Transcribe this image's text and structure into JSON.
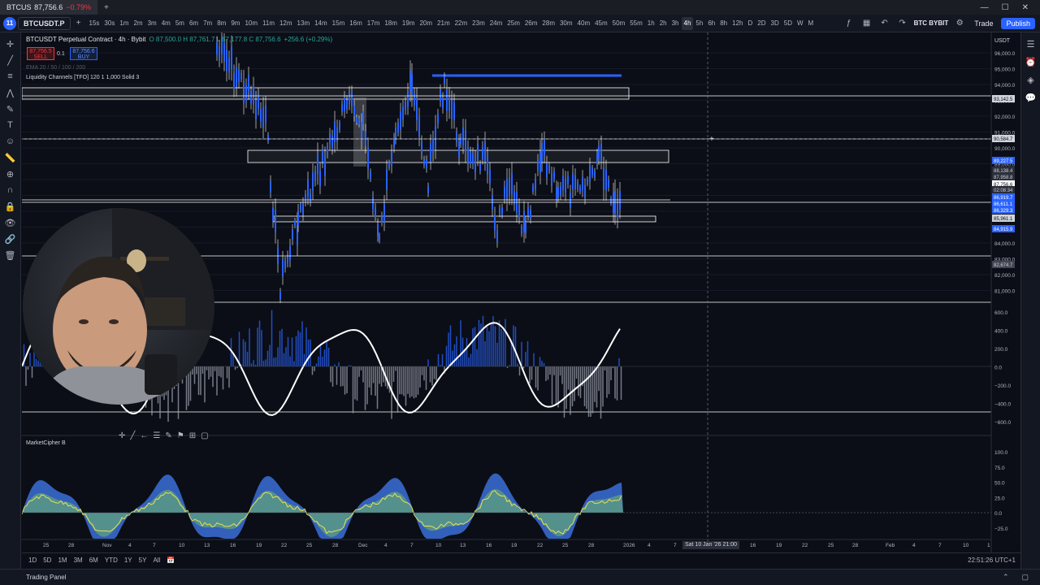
{
  "browser": {
    "tab_title": "BTCUSDT.P",
    "tab_price": "87,756.6",
    "tab_change": "−0.79%",
    "new_tab": "+",
    "window_controls": [
      "—",
      "☐",
      "✕"
    ]
  },
  "toolbar": {
    "symbol": "BTCUSDT.P",
    "timeframes": [
      "15s",
      "30s",
      "1m",
      "2m",
      "3m",
      "4m",
      "5m",
      "6m",
      "7m",
      "8m",
      "9m",
      "10m",
      "11m",
      "12m",
      "13m",
      "14m",
      "15m",
      "16m",
      "17m",
      "18m",
      "19m",
      "20m",
      "21m",
      "22m",
      "23m",
      "24m",
      "25m",
      "26m",
      "28m",
      "30m",
      "40m",
      "45m",
      "50m",
      "55m",
      "1h",
      "2h",
      "3h",
      "4h",
      "5h",
      "6h",
      "8h",
      "12h",
      "D",
      "2D",
      "3D",
      "5D",
      "W",
      "M"
    ],
    "active_timeframe": "4h",
    "exchange": "BTC BYBIT",
    "trade_label": "Trade",
    "publish_label": "Publish"
  },
  "legend": {
    "symbol": "BTCUSDT Perpetual Contract · 4h · Bybit",
    "ohlc": "O 87,500.0 H 87,761.7 L 87,177.8 C 87,756.6",
    "change": "+256.6 (+0.29%)",
    "sell_price": "87,756.5",
    "sell_label": "SELL",
    "spread": "0.1",
    "buy_price": "87,756.6",
    "buy_label": "BUY",
    "ema": "EMA 20 / 50 / 100 / 200",
    "liquidity": "Liquidity Channels [TFO] 120 1 1,000 Solid 3",
    "marketcipher": "MarketCipher B"
  },
  "price_axis": {
    "ticks": [
      "96,000.0",
      "95,000.0",
      "94,000.0",
      "93,000.0",
      "92,000.0",
      "91,000.0",
      "90,000.0",
      "89,000.0",
      "88,000.0",
      "87,000.0",
      "86,000.0",
      "85,000.0",
      "84,000.0",
      "83,000.0",
      "82,000.0",
      "81,000.0"
    ],
    "labels": [
      "93,142.5",
      "90,584.7",
      "89,227.5",
      "88,138.4",
      "87,958.8",
      "87,756.6",
      "02:08:34",
      "86,919.7",
      "86,611.1",
      "86,329.3",
      "85,961.1",
      "84,915.9",
      "82,674.7"
    ],
    "currency": "USDT"
  },
  "osc_axis": {
    "ticks": [
      "600.0",
      "400.0",
      "200.0",
      "0.0",
      "−200.0",
      "−400.0",
      "−600.0"
    ]
  },
  "mc_axis": {
    "ticks": [
      "100.0",
      "75.0",
      "50.0",
      "25.0",
      "0.0",
      "−25.0"
    ]
  },
  "time_axis": {
    "ticks": [
      "25",
      "28",
      "Nov",
      "4",
      "7",
      "10",
      "13",
      "16",
      "19",
      "22",
      "25",
      "28",
      "Dec",
      "4",
      "7",
      "10",
      "13",
      "16",
      "19",
      "22",
      "25",
      "28",
      "2026",
      "4",
      "7"
    ],
    "future_ticks": [
      "16",
      "19",
      "22",
      "25",
      "28",
      "Feb",
      "4",
      "7",
      "10",
      "1"
    ],
    "cursor_label": "Sat 10 Jan '26   21:00"
  },
  "bottom": {
    "ranges": [
      "1D",
      "5D",
      "1M",
      "3M",
      "6M",
      "YTD",
      "1Y",
      "5Y",
      "All"
    ],
    "clock": "22:51:26 UTC+1",
    "panel": "Trading Panel"
  },
  "colors": {
    "bg": "#0b0e16",
    "candle": "#2962ff",
    "wick": "#ffffff",
    "accent": "#2962ff",
    "sell": "#f23645",
    "green": "#26a69a",
    "wave_green": "#7ccf57"
  }
}
